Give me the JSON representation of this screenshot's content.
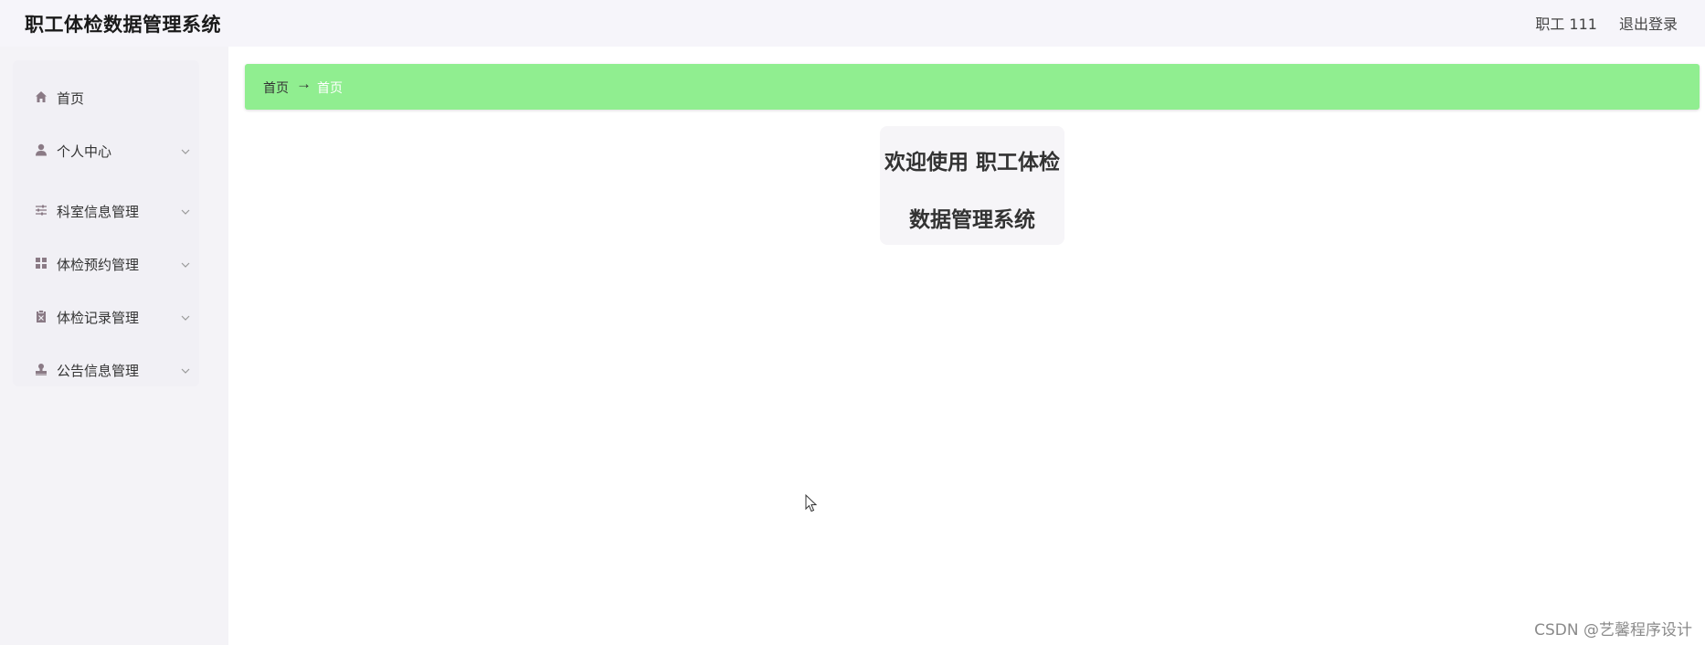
{
  "header": {
    "title": "职工体检数据管理系统",
    "user_label": "职工 111",
    "logout_label": "退出登录"
  },
  "sidebar": {
    "items": [
      {
        "label": "首页",
        "icon": "home-icon",
        "has_submenu": false
      },
      {
        "label": "个人中心",
        "icon": "user-icon",
        "has_submenu": true
      },
      {
        "label": "科室信息管理",
        "icon": "sliders-icon",
        "has_submenu": true
      },
      {
        "label": "体检预约管理",
        "icon": "grid-icon",
        "has_submenu": true
      },
      {
        "label": "体检记录管理",
        "icon": "clipboard-icon",
        "has_submenu": true
      },
      {
        "label": "公告信息管理",
        "icon": "stamp-icon",
        "has_submenu": true
      }
    ]
  },
  "breadcrumb": {
    "home": "首页",
    "separator": "→",
    "current": "首页"
  },
  "welcome": {
    "line1": "欢迎使用 职工体检",
    "line2": "数据管理系统"
  },
  "watermark": "CSDN @艺馨程序设计",
  "colors": {
    "breadcrumb_bg": "#90ee90",
    "icon": "#8a7a85",
    "sidebar_bg": "#f4f3f7"
  }
}
